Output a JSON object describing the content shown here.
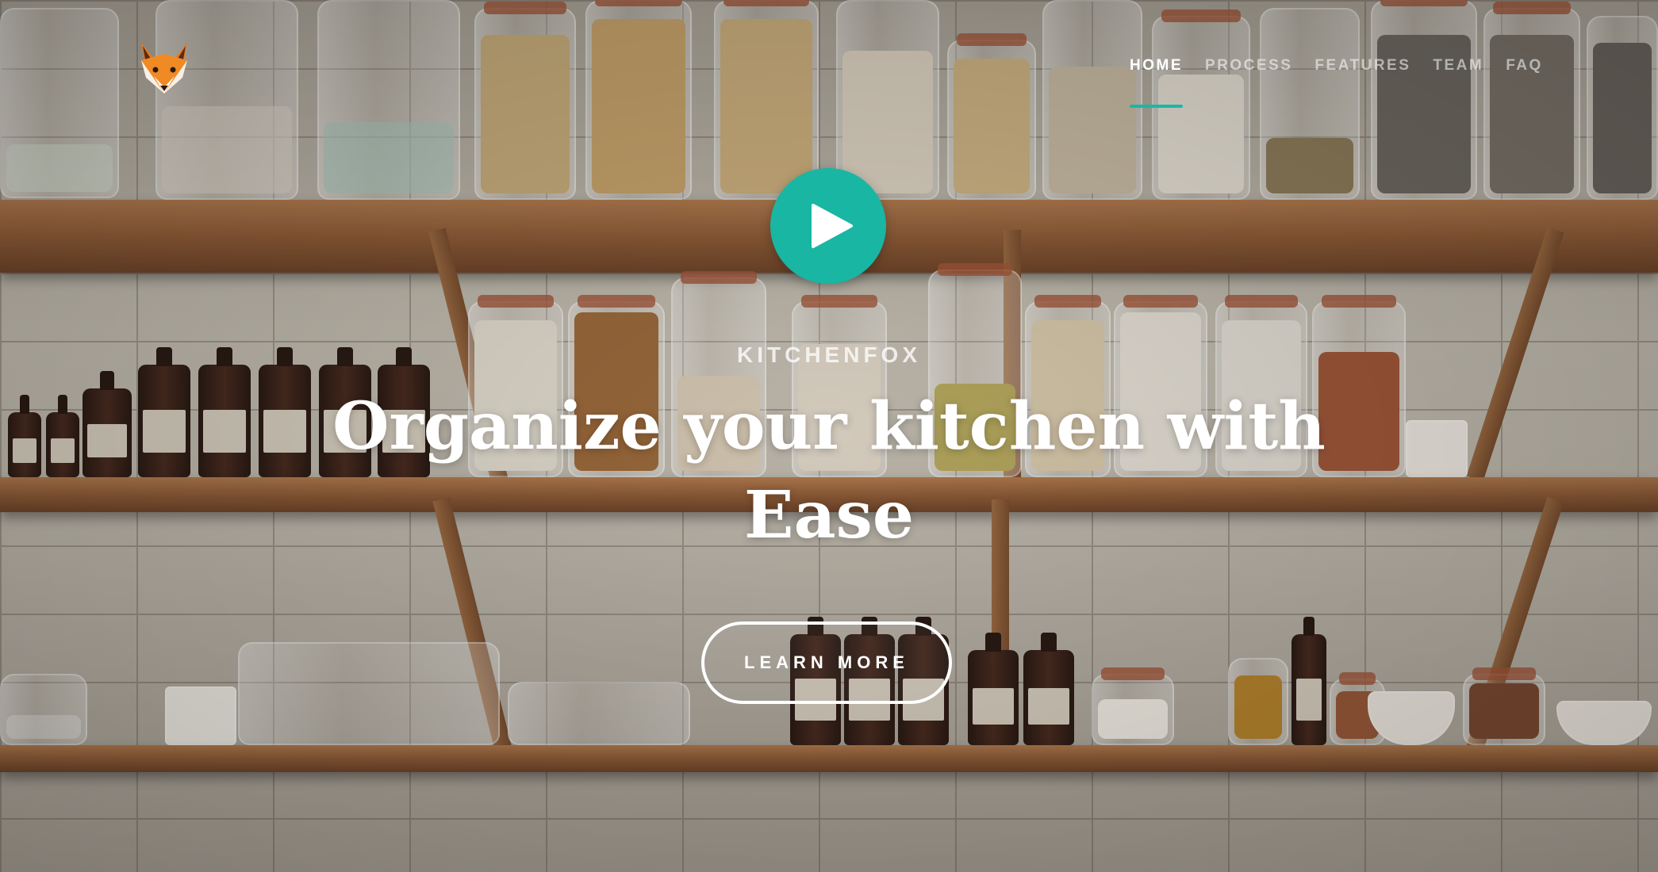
{
  "brand": {
    "logo_icon": "fox-icon"
  },
  "nav": {
    "items": [
      {
        "label": "HOME",
        "active": true
      },
      {
        "label": "PROCESS",
        "active": false
      },
      {
        "label": "FEATURES",
        "active": false
      },
      {
        "label": "TEAM",
        "active": false
      },
      {
        "label": "FAQ",
        "active": false
      }
    ],
    "accent_color": "#17b8a6"
  },
  "hero": {
    "play_icon": "play-icon",
    "eyebrow": "KITCHENFOX",
    "headline": "Organize your kitchen with Ease",
    "cta_label": "LEARN MORE",
    "play_color": "#19b6a3"
  }
}
